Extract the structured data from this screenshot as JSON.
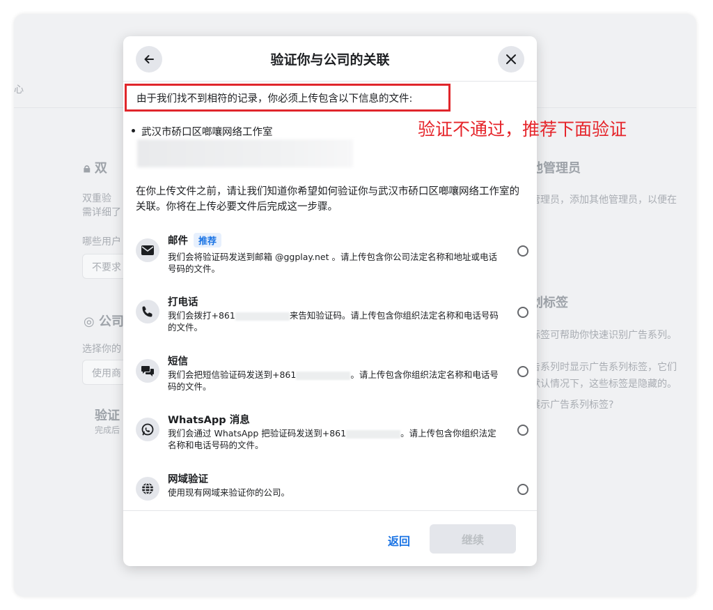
{
  "background": {
    "left_fragment_1": "心",
    "left_fragment_2": "双",
    "left_fragment_3": "双重验",
    "left_fragment_4": "需详细了",
    "left_fragment_5": "哪些用户",
    "left_fragment_6": "不要求",
    "left_fragment_7": "公司",
    "left_fragment_8": "选择你的",
    "left_fragment_9": "使用商",
    "left_fragment_10": "验证",
    "left_fragment_11": "完成后",
    "right_heading_1": "他管理员",
    "right_text_1": "管理员，添加其他管理员，以便在",
    "right_heading_2": "划标签",
    "right_text_2": "标签可帮助你快速识别广告系列。",
    "right_text_3": "告系列时显示广告系列标签，它们",
    "right_text_4": "默认情况下，这些标签是隐藏的。",
    "right_text_5": "展示广告系列标签?"
  },
  "modal": {
    "title": "验证你与公司的关联",
    "intro": "由于我们找不到相符的记录，你必须上传包含以下信息的文件:",
    "company": "武汉市硚口区啷嚷网络工作室",
    "description": "在你上传文件之前，请让我们知道你希望如何验证你与武汉市硚口区啷嚷网络工作室的关联。你将在上传必要文件后完成这一步骤。",
    "options": [
      {
        "title": "邮件",
        "tag": "推荐",
        "desc": "我们会将验证码发送到邮箱 @ggplay.net 。请上传包含你公司法定名称和地址或电话号码的文件。"
      },
      {
        "title": "打电话",
        "desc_a": "我们会拨打+861",
        "desc_b": "来告知验证码。请上传包含你组织法定名称和电话号码的文件。"
      },
      {
        "title": "短信",
        "desc_a": "我们会把短信验证码发送到+861",
        "desc_b": "。请上传包含你组织法定名称和电话号码的文件。"
      },
      {
        "title": "WhatsApp 消息",
        "desc_a": "我们会通过 WhatsApp 把验证码发送到+861",
        "desc_b": "。请上传包含你组织法定名称和电话号码的文件。"
      },
      {
        "title": "网域验证",
        "desc": "使用现有网域来验证你的公司。"
      }
    ],
    "back_label": "返回",
    "continue_label": "继续"
  },
  "annotation": "验证不通过，推荐下面验证",
  "colors": {
    "accent": "#1b74e4",
    "highlight_border": "#e0262b",
    "annotation_text": "#e5242a"
  },
  "icons": {
    "back": "arrow-left-icon",
    "close": "close-icon",
    "email": "envelope-icon",
    "phone": "phone-icon",
    "sms": "chat-bubbles-icon",
    "whatsapp": "whatsapp-icon",
    "domain": "globe-icon"
  }
}
